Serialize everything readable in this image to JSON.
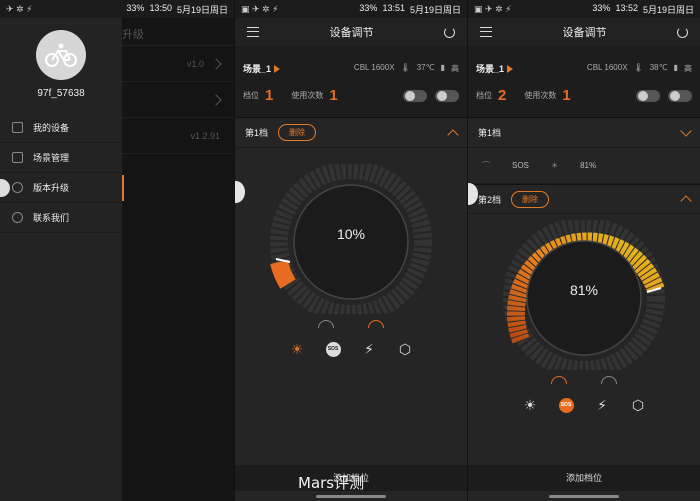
{
  "status": [
    {
      "battery": "33%",
      "time": "13:50",
      "date": "5月19日周日"
    },
    {
      "battery": "33%",
      "time": "13:51",
      "date": "5月19日周日"
    },
    {
      "battery": "33%",
      "time": "13:52",
      "date": "5月19日周日"
    }
  ],
  "drawer": {
    "username": "97f_57638",
    "items": [
      {
        "label": "我的设备"
      },
      {
        "label": "场景管理"
      },
      {
        "label": "版本升级"
      },
      {
        "label": "联系我们"
      }
    ],
    "behind": {
      "title_fragment": "升级",
      "versions": [
        "v1.0",
        "",
        "v1.2.91"
      ]
    }
  },
  "screen2": {
    "title": "设备调节",
    "scene": {
      "name": "场景_1",
      "device": "CBL 1600X",
      "temp": "37℃",
      "level_text": "高"
    },
    "gear_label": "档位",
    "gear_value": "1",
    "uses_label": "使用次数",
    "uses_value": "1",
    "gear1": {
      "label": "第1档",
      "delete": "删除",
      "percent": "10%"
    },
    "add_label": "添加档位"
  },
  "screen3": {
    "title": "设备调节",
    "scene": {
      "name": "场景_1",
      "device": "CBL 1600X",
      "temp": "38℃",
      "level_text": "高"
    },
    "gear_label": "档位",
    "gear_value": "2",
    "uses_label": "使用次数",
    "uses_value": "1",
    "gear1": {
      "label": "第1档",
      "mode": "SOS",
      "percent": "81%"
    },
    "gear2": {
      "label": "第2档",
      "delete": "删除",
      "percent": "81%"
    },
    "add_label": "添加档位"
  },
  "watermark": "Mars评测",
  "accent": "#e86b22",
  "levels": {
    "screen2_dial": 0.1,
    "screen3_dial": 0.81
  }
}
